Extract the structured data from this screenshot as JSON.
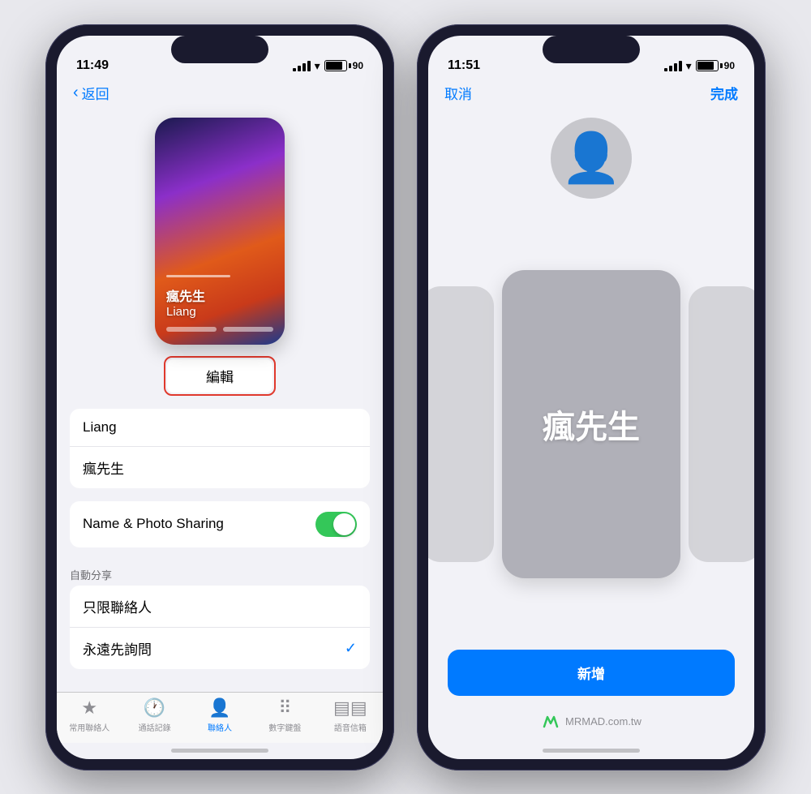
{
  "left_phone": {
    "status_bar": {
      "time": "11:49",
      "battery": "90"
    },
    "nav": {
      "back_label": "返回"
    },
    "card": {
      "name_cn": "瘋先生",
      "name_en": "Liang"
    },
    "edit_button": "編輯",
    "form": {
      "first_name": "Liang",
      "last_name": "瘋先生",
      "name_photo_label": "Name & Photo Sharing"
    },
    "section_header": "自動分享",
    "settings_rows": [
      {
        "label": "只限聯絡人",
        "checked": false
      },
      {
        "label": "永遠先詢問",
        "checked": true
      }
    ],
    "tabs": [
      {
        "label": "常用聯絡人",
        "icon": "★",
        "active": false
      },
      {
        "label": "通話記錄",
        "icon": "🕐",
        "active": false
      },
      {
        "label": "聯絡人",
        "icon": "👤",
        "active": true
      },
      {
        "label": "數字鍵盤",
        "icon": "⠿",
        "active": false
      },
      {
        "label": "語音信箱",
        "icon": "☰☰",
        "active": false
      }
    ]
  },
  "right_phone": {
    "status_bar": {
      "time": "11:51",
      "battery": "90"
    },
    "nav": {
      "cancel_label": "取消",
      "done_label": "完成"
    },
    "carousel_main_text": "瘋先生",
    "add_button_label": "新增",
    "watermark": "MRMAD.com.tw"
  }
}
